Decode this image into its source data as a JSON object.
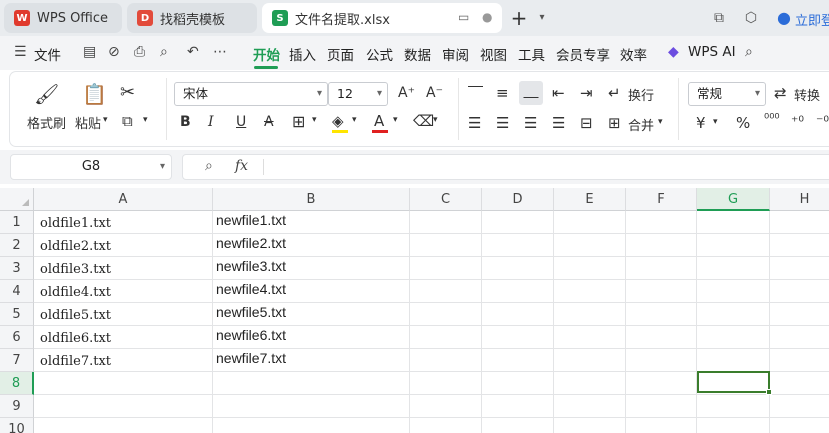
{
  "tabs": [
    {
      "label": "WPS Office",
      "active": false
    },
    {
      "label": "找稻壳模板",
      "active": false
    },
    {
      "label": "文件名提取.xlsx",
      "active": true
    }
  ],
  "logos": {
    "wps": "W",
    "doc": "D",
    "xls": "S"
  },
  "topbar": {
    "login_label": "立即登"
  },
  "menu": {
    "file_label": "文件",
    "items": [
      "开始",
      "插入",
      "页面",
      "公式",
      "数据",
      "审阅",
      "视图",
      "工具",
      "会员专享",
      "效率"
    ],
    "active": "开始",
    "wps_ai_label": "WPS AI"
  },
  "ribbon": {
    "format_painter": "格式刷",
    "paste": "粘贴",
    "font_name": "宋体",
    "font_size": "12",
    "wrap_label": "换行",
    "merge_label": "合并",
    "number_format": "常规",
    "convert_label": "转换",
    "font_color": "#e02020",
    "highlight_color": "#ffe500"
  },
  "formula_bar": {
    "name_box": "G8",
    "fx_label": "fx",
    "formula": ""
  },
  "sheet": {
    "columns": [
      "A",
      "B",
      "C",
      "D",
      "E",
      "F",
      "G",
      "H"
    ],
    "rows": [
      "1",
      "2",
      "3",
      "4",
      "5",
      "6",
      "7",
      "8",
      "9",
      "10"
    ],
    "selected_column": "G",
    "selected_row": "8",
    "colA": [
      "oldfile1.txt",
      "oldfile2.txt",
      "oldfile3.txt",
      "oldfile4.txt",
      "oldfile5.txt",
      "oldfile6.txt",
      "oldfile7.txt"
    ],
    "colB": [
      "newfile1.txt",
      "newfile2.txt",
      "newfile3.txt",
      "newfile4.txt",
      "newfile5.txt",
      "newfile6.txt",
      "newfile7.txt"
    ]
  }
}
